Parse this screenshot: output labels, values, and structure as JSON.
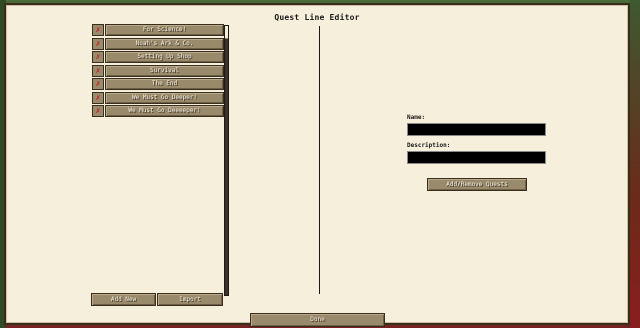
{
  "window": {
    "title": "Quest Line Editor"
  },
  "quest_lines": [
    {
      "label": "For Science!"
    },
    {
      "label": "Noah's Ark & Co."
    },
    {
      "label": "Setting Up Shop"
    },
    {
      "label": "Survival"
    },
    {
      "label": "The End"
    },
    {
      "label": "We Must Go Deeper!"
    },
    {
      "label": "We Must Go Deeeeper!"
    }
  ],
  "delete_glyph": "✗",
  "list_buttons": {
    "add_new": "Add New",
    "import": "Import"
  },
  "editor": {
    "name_label": "Name:",
    "name_value": "",
    "description_label": "Description:",
    "description_value": "",
    "add_remove_label": "Add/Remove Quests"
  },
  "footer": {
    "done_label": "Done"
  },
  "colors": {
    "panel": "#f5efdc",
    "button": "#9a8a6c",
    "delete_mark": "#c0201a"
  }
}
